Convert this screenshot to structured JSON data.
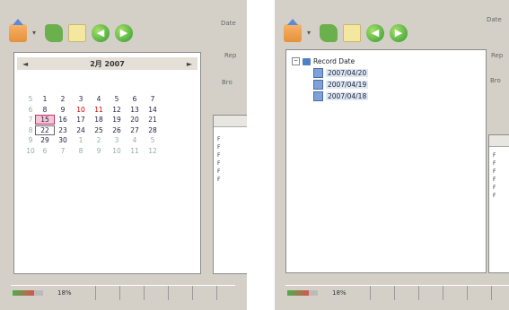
{
  "left": {
    "side_labels": [
      "Date",
      "Rep",
      "Bro"
    ],
    "calendar": {
      "title": "2月 2007",
      "prev": "◄",
      "next": "►",
      "weeks": [
        {
          "wk": "5",
          "days": [
            "",
            "1",
            "2",
            "3",
            "4",
            "5",
            "6",
            "7"
          ]
        },
        {
          "wk": "6",
          "days": [
            "",
            "8",
            "9",
            "10",
            "11",
            "12",
            "13",
            "14"
          ]
        },
        {
          "wk": "7",
          "days": [
            "",
            "15",
            "16",
            "17",
            "18",
            "19",
            "20",
            "21"
          ]
        },
        {
          "wk": "8",
          "days": [
            "",
            "22",
            "23",
            "24",
            "25",
            "26",
            "27",
            "28"
          ]
        },
        {
          "wk": "9",
          "days": [
            "",
            "29",
            "30",
            "1",
            "2",
            "3",
            "4",
            "5"
          ]
        },
        {
          "wk": "10",
          "days": [
            "",
            "6",
            "7",
            "8",
            "9",
            "10",
            "11",
            "12"
          ]
        }
      ]
    },
    "status_text": "18%"
  },
  "right": {
    "side_labels": [
      "Date",
      "Rep",
      "Bro"
    ],
    "tree": {
      "root": "Record Date",
      "children": [
        "2007/04/20",
        "2007/04/19",
        "2007/04/18"
      ]
    },
    "status_text": "18%"
  },
  "progress_fraction": 0.7
}
